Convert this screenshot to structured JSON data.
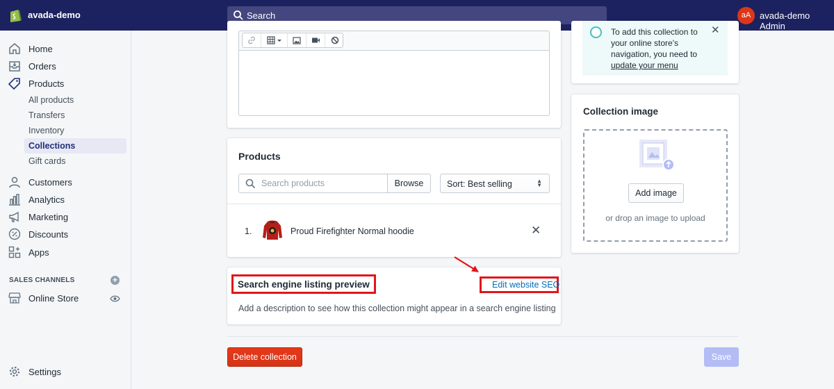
{
  "topbar": {
    "shop_name": "avada-demo",
    "search_placeholder": "Search",
    "avatar_initials": "aA",
    "admin_name": "avada-demo Admin"
  },
  "sidebar": {
    "nav": [
      {
        "label": "Home",
        "icon": "home-icon"
      },
      {
        "label": "Orders",
        "icon": "orders-icon"
      },
      {
        "label": "Products",
        "icon": "tag-icon"
      }
    ],
    "subnav": [
      {
        "label": "All products"
      },
      {
        "label": "Transfers"
      },
      {
        "label": "Inventory"
      },
      {
        "label": "Collections",
        "active": true
      },
      {
        "label": "Gift cards"
      }
    ],
    "nav2": [
      {
        "label": "Customers",
        "icon": "person-icon"
      },
      {
        "label": "Analytics",
        "icon": "bar-chart-icon"
      },
      {
        "label": "Marketing",
        "icon": "megaphone-icon"
      },
      {
        "label": "Discounts",
        "icon": "percent-icon"
      },
      {
        "label": "Apps",
        "icon": "apps-icon"
      }
    ],
    "channels_heading": "SALES CHANNELS",
    "online_store": "Online Store",
    "settings": "Settings"
  },
  "products_card": {
    "title": "Products",
    "search_placeholder": "Search products",
    "browse": "Browse",
    "sort": "Sort: Best selling",
    "items": [
      {
        "index": "1.",
        "name": "Proud Firefighter Normal hoodie"
      }
    ]
  },
  "seo_card": {
    "title": "Search engine listing preview",
    "edit_link": "Edit website SEO",
    "description": "Add a description to see how this collection might appear in a search engine listing"
  },
  "info_banner": {
    "text": "To add this collection to your online store's navigation, you need to",
    "link": "update your menu"
  },
  "image_card": {
    "title": "Collection image",
    "add_button": "Add image",
    "hint": "or drop an image to upload"
  },
  "actions": {
    "delete": "Delete collection",
    "save": "Save"
  },
  "colors": {
    "topbar": "#1c2260",
    "accent": "#006fbb",
    "danger": "#de3618",
    "annotation": "#e0151a"
  }
}
